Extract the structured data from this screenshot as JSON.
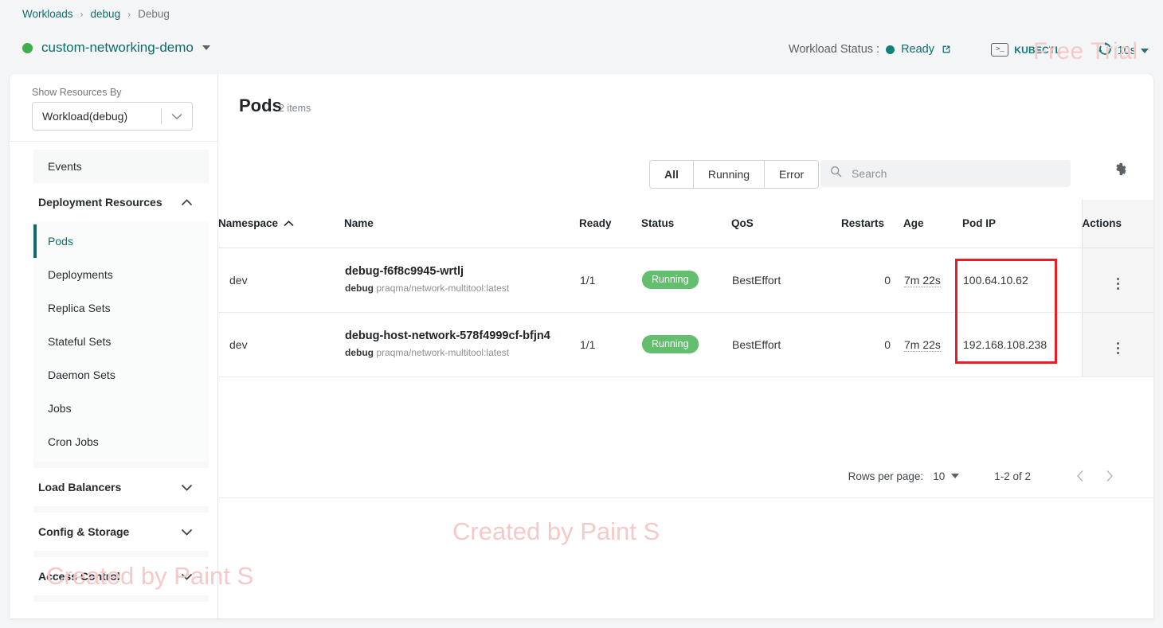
{
  "breadcrumb": {
    "items": [
      {
        "label": "Workloads",
        "current": false
      },
      {
        "label": "debug",
        "current": false
      },
      {
        "label": "Debug",
        "current": true
      }
    ],
    "separator": "›"
  },
  "header": {
    "workload_name": "custom-networking-demo",
    "status_label": "Workload Status :",
    "status_value": "Ready",
    "kubectl_label": "KUBECTL",
    "refresh_interval": "10s",
    "status_dot_color": "#12807a",
    "title_dot_color": "#3fae4b",
    "accent_color": "#0b6e6b"
  },
  "sidebar": {
    "show_resources_label": "Show Resources By",
    "selected_scope": "Workload(debug)",
    "top_items": [
      {
        "label": "Events",
        "active": false
      }
    ],
    "groups": [
      {
        "label": "Deployment Resources",
        "expanded": true,
        "items": [
          {
            "label": "Pods",
            "active": true
          },
          {
            "label": "Deployments",
            "active": false
          },
          {
            "label": "Replica Sets",
            "active": false
          },
          {
            "label": "Stateful Sets",
            "active": false
          },
          {
            "label": "Daemon Sets",
            "active": false
          },
          {
            "label": "Jobs",
            "active": false
          },
          {
            "label": "Cron Jobs",
            "active": false
          }
        ]
      },
      {
        "label": "Load Balancers",
        "expanded": false,
        "items": []
      },
      {
        "label": "Config & Storage",
        "expanded": false,
        "items": []
      },
      {
        "label": "Access Control",
        "expanded": false,
        "items": []
      }
    ]
  },
  "main": {
    "title": "Pods",
    "item_count": "2 items",
    "filters": [
      {
        "label": "All",
        "selected": true
      },
      {
        "label": "Running",
        "selected": false
      },
      {
        "label": "Error",
        "selected": false
      }
    ],
    "search": {
      "value": "",
      "placeholder": "Search"
    },
    "table": {
      "columns": [
        {
          "key": "namespace",
          "label": "Namespace",
          "sorted": "asc"
        },
        {
          "key": "name",
          "label": "Name",
          "sorted": ""
        },
        {
          "key": "ready",
          "label": "Ready",
          "sorted": ""
        },
        {
          "key": "status",
          "label": "Status",
          "sorted": ""
        },
        {
          "key": "qos",
          "label": "QoS",
          "sorted": ""
        },
        {
          "key": "restarts",
          "label": "Restarts",
          "sorted": ""
        },
        {
          "key": "age",
          "label": "Age",
          "sorted": ""
        },
        {
          "key": "pod_ip",
          "label": "Pod IP",
          "sorted": ""
        },
        {
          "key": "actions",
          "label": "Actions",
          "sorted": ""
        }
      ],
      "rows": [
        {
          "namespace": "dev",
          "name": "debug-f6f8c9945-wrtlj",
          "container": "debug",
          "image": "praqma/network-multitool:latest",
          "ready": "1/1",
          "status": "Running",
          "qos": "BestEffort",
          "restarts": "0",
          "age": "7m 22s",
          "pod_ip": "100.64.10.62"
        },
        {
          "namespace": "dev",
          "name": "debug-host-network-578f4999cf-bfjn4",
          "container": "debug",
          "image": "praqma/network-multitool:latest",
          "ready": "1/1",
          "status": "Running",
          "qos": "BestEffort",
          "restarts": "0",
          "age": "7m 22s",
          "pod_ip": "192.168.108.238"
        }
      ]
    },
    "pagination": {
      "rows_per_page_label": "Rows per page:",
      "rows_per_page_value": "10",
      "range_label": "1-2 of 2"
    },
    "status_badge_color": "#63bf6e",
    "annotation_color": "#ee1b24"
  },
  "watermarks": [
    {
      "text": "Free Trial",
      "color": "#f7c8c8"
    },
    {
      "text": "Created by Paint S",
      "color": "#f7c8c8"
    },
    {
      "text": "Created by Paint S",
      "color": "#f7c8c8"
    }
  ]
}
